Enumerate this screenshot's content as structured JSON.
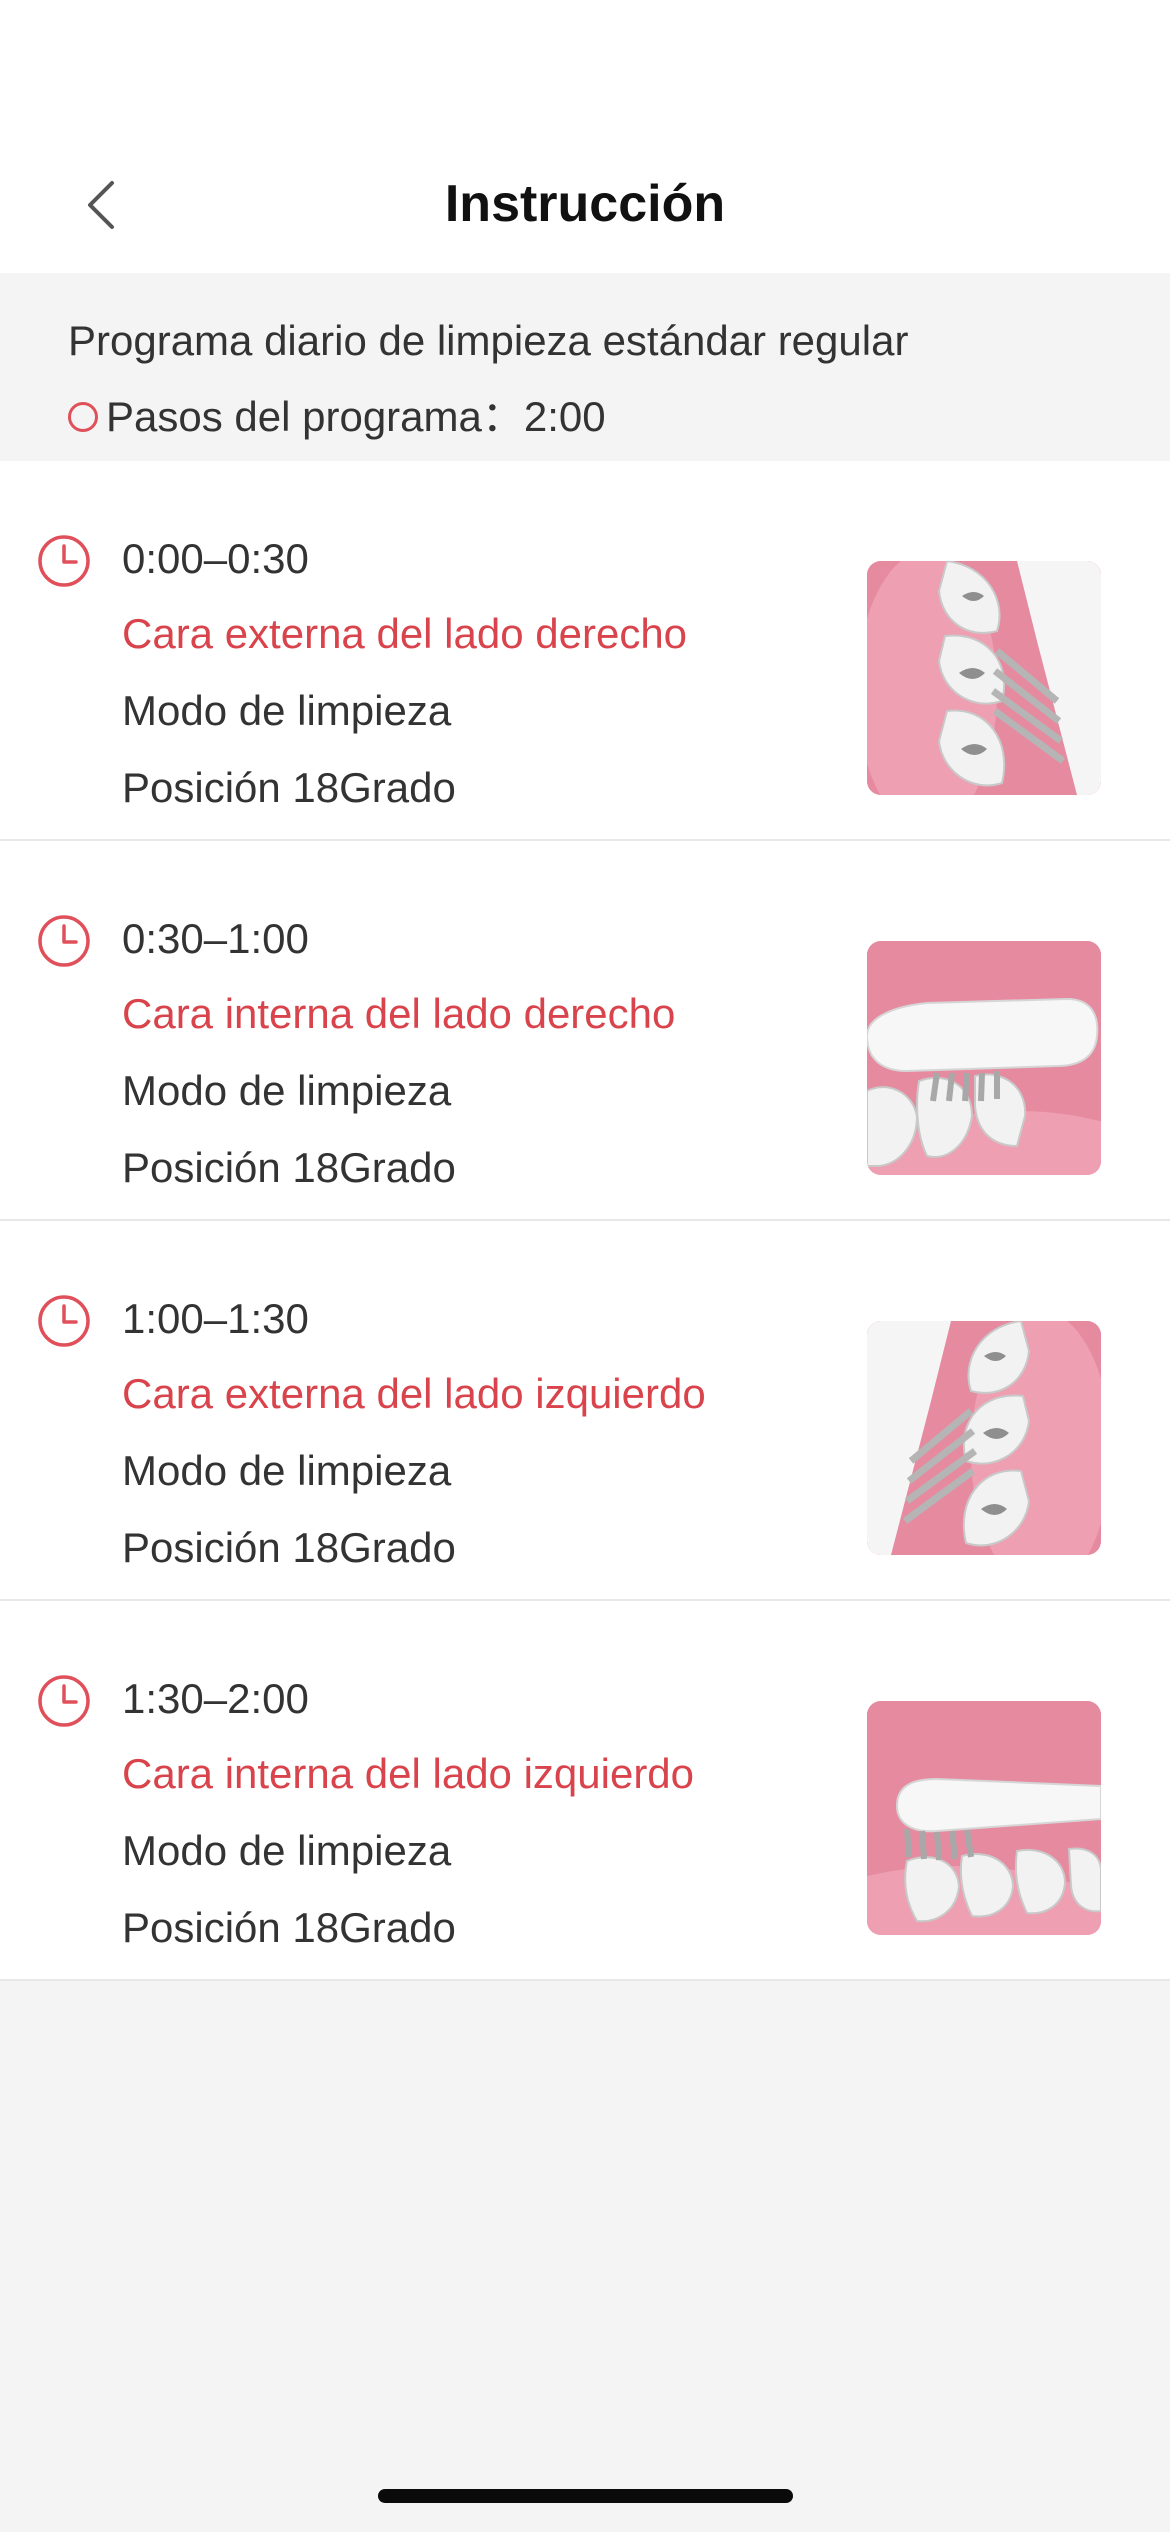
{
  "header": {
    "title": "Instrucción",
    "back_icon": "chevron-left-icon"
  },
  "summary": {
    "title": "Programa diario de limpieza estándar regular",
    "steps_text": "Pasos del programa：2:00",
    "steps_icon": "circle-icon"
  },
  "steps": [
    {
      "time": "0:00–0:30",
      "area": "Cara externa del lado derecho",
      "mode": "Modo de limpieza",
      "position": "Posición 18Grado",
      "icon": "clock-icon",
      "image": "outer-right-teeth-brush-image"
    },
    {
      "time": "0:30–1:00",
      "area": "Cara interna del lado derecho",
      "mode": "Modo de limpieza",
      "position": "Posición 18Grado",
      "icon": "clock-icon",
      "image": "inner-right-teeth-brush-image"
    },
    {
      "time": "1:00–1:30",
      "area": "Cara externa del lado izquierdo",
      "mode": "Modo de limpieza",
      "position": "Posición 18Grado",
      "icon": "clock-icon",
      "image": "outer-left-teeth-brush-image"
    },
    {
      "time": "1:30–2:00",
      "area": "Cara interna del lado izquierdo",
      "mode": "Modo de limpieza",
      "position": "Posición 18Grado",
      "icon": "clock-icon",
      "image": "inner-left-teeth-brush-image"
    }
  ],
  "colors": {
    "accent": "#d9434b",
    "text": "#333333",
    "background": "#f4f4f4",
    "thumb_background": "#e68aa0"
  }
}
